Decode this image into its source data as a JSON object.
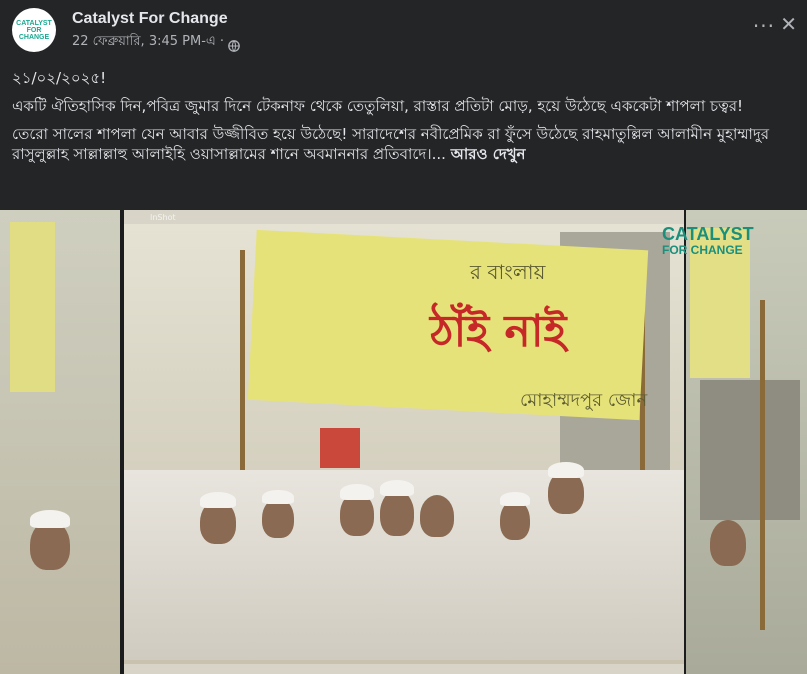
{
  "post": {
    "page_name": "Catalyst For Change",
    "avatar_text": "CATALYST FOR CHANGE",
    "timestamp": "22 ফেব্রুয়ারি, 3:45 PM-এ ·",
    "more_label": "···",
    "close_label": "✕",
    "paragraphs": [
      "২১/০২/২০২৫!",
      "একটি ঐতিহাসিক দিন,পবিত্র জুমার দিনে টেকনাফ থেকে তেতুলিয়া, রাস্তার প্রতিটা মোড়, হয়ে উঠেছে এককেটা শাপলা চত্বর!",
      "তেরো সালের শাপলা যেন আবার উজ্জীবিত হয়ে উঠেছে! সারাদেশের নবীপ্রেমিক রা ফুঁসে উঠেছে রাহমাতুল্লিল আলামীন মুহাম্মাদুর রাসুলুল্লাহ সাল্লাল্লাহু আলাইহি ওয়াসাল্লামের শানে অবমাননার প্রতিবাদে।..."
    ],
    "see_more": "আরও দেখুন"
  },
  "media": {
    "watermark_line1": "CATALYST",
    "watermark_line2": "FOR CHANGE",
    "inshot_label": "InShot",
    "banner_top": "র বাংলায়",
    "banner_main": "ঠাঁই নাই",
    "banner_bottom": "মোহাম্মদপুর জোন"
  },
  "colors": {
    "background": "#242526",
    "text_primary": "#e4e6eb",
    "text_secondary": "#b0b3b8",
    "brand_teal": "#1aa890",
    "banner_yellow": "#e6e27a",
    "banner_red": "#c62828"
  },
  "icons": [
    "globe-icon",
    "more-options-icon",
    "close-icon"
  ]
}
